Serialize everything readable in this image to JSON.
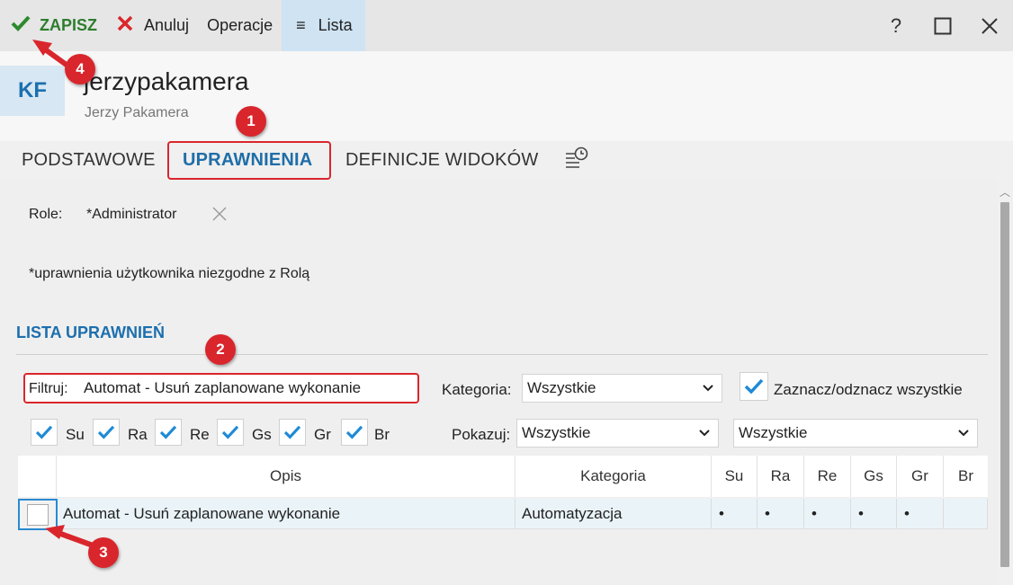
{
  "toolbar": {
    "save_label": "ZAPISZ",
    "cancel_label": "Anuluj",
    "operations_label": "Operacje",
    "list_label": "Lista",
    "help_label": "?"
  },
  "header": {
    "avatar_initials": "KF",
    "login": "jerzypakamera",
    "full_name": "Jerzy Pakamera"
  },
  "tabs": [
    {
      "label": "PODSTAWOWE"
    },
    {
      "label": "UPRAWNIENIA"
    },
    {
      "label": "DEFINICJE WIDOKÓW"
    }
  ],
  "roles": {
    "label": "Role:",
    "value": "*Administrator"
  },
  "note": "*uprawnienia użytkownika niezgodne z Rolą",
  "permissions": {
    "title": "LISTA UPRAWNIEŃ",
    "filter_label": "Filtruj:",
    "filter_value": "Automat - Usuń zaplanowane wykonanie",
    "category_label": "Kategoria:",
    "category_value": "Wszystkie",
    "select_all_label": "Zaznacz/odznacz wszystkie",
    "show_label": "Pokazuj:",
    "show_value": "Wszystkie",
    "show_value2": "Wszystkie",
    "flags": [
      {
        "label": "Su",
        "checked": true
      },
      {
        "label": "Ra",
        "checked": true
      },
      {
        "label": "Re",
        "checked": true
      },
      {
        "label": "Gs",
        "checked": true
      },
      {
        "label": "Gr",
        "checked": true
      },
      {
        "label": "Br",
        "checked": true
      }
    ]
  },
  "table": {
    "columns": [
      "Opis",
      "Kategoria",
      "Su",
      "Ra",
      "Re",
      "Gs",
      "Gr",
      "Br"
    ],
    "rows": [
      {
        "opis": "Automat - Usuń zaplanowane wykonanie",
        "kategoria": "Automatyzacja",
        "su": "•",
        "ra": "•",
        "re": "•",
        "gs": "•",
        "gr": "•",
        "br": "",
        "checked": false
      }
    ]
  },
  "annotations": [
    "1",
    "2",
    "3",
    "4"
  ],
  "colors": {
    "accent": "#1c6fae",
    "save_green": "#2d7d2d",
    "annotation_red": "#d9262c",
    "check_blue": "#1e8ad6"
  }
}
